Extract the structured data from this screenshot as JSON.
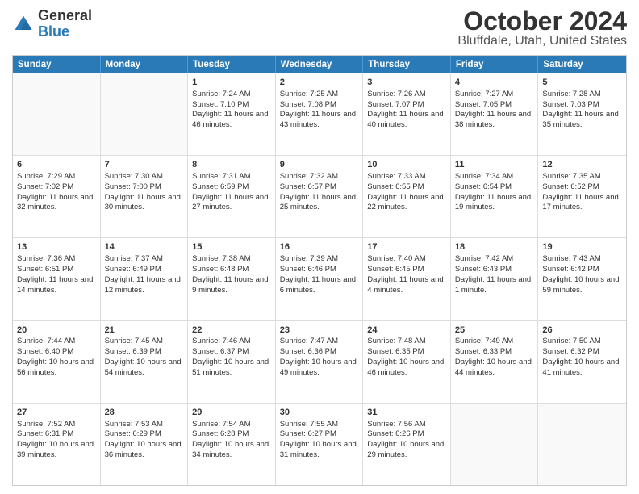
{
  "logo": {
    "line1": "General",
    "line2": "Blue"
  },
  "title": "October 2024",
  "subtitle": "Bluffdale, Utah, United States",
  "header_days": [
    "Sunday",
    "Monday",
    "Tuesday",
    "Wednesday",
    "Thursday",
    "Friday",
    "Saturday"
  ],
  "rows": [
    [
      {
        "day": "",
        "content": "",
        "empty": true
      },
      {
        "day": "",
        "content": "",
        "empty": true
      },
      {
        "day": "1",
        "content": "Sunrise: 7:24 AM\nSunset: 7:10 PM\nDaylight: 11 hours and 46 minutes."
      },
      {
        "day": "2",
        "content": "Sunrise: 7:25 AM\nSunset: 7:08 PM\nDaylight: 11 hours and 43 minutes."
      },
      {
        "day": "3",
        "content": "Sunrise: 7:26 AM\nSunset: 7:07 PM\nDaylight: 11 hours and 40 minutes."
      },
      {
        "day": "4",
        "content": "Sunrise: 7:27 AM\nSunset: 7:05 PM\nDaylight: 11 hours and 38 minutes."
      },
      {
        "day": "5",
        "content": "Sunrise: 7:28 AM\nSunset: 7:03 PM\nDaylight: 11 hours and 35 minutes."
      }
    ],
    [
      {
        "day": "6",
        "content": "Sunrise: 7:29 AM\nSunset: 7:02 PM\nDaylight: 11 hours and 32 minutes."
      },
      {
        "day": "7",
        "content": "Sunrise: 7:30 AM\nSunset: 7:00 PM\nDaylight: 11 hours and 30 minutes."
      },
      {
        "day": "8",
        "content": "Sunrise: 7:31 AM\nSunset: 6:59 PM\nDaylight: 11 hours and 27 minutes."
      },
      {
        "day": "9",
        "content": "Sunrise: 7:32 AM\nSunset: 6:57 PM\nDaylight: 11 hours and 25 minutes."
      },
      {
        "day": "10",
        "content": "Sunrise: 7:33 AM\nSunset: 6:55 PM\nDaylight: 11 hours and 22 minutes."
      },
      {
        "day": "11",
        "content": "Sunrise: 7:34 AM\nSunset: 6:54 PM\nDaylight: 11 hours and 19 minutes."
      },
      {
        "day": "12",
        "content": "Sunrise: 7:35 AM\nSunset: 6:52 PM\nDaylight: 11 hours and 17 minutes."
      }
    ],
    [
      {
        "day": "13",
        "content": "Sunrise: 7:36 AM\nSunset: 6:51 PM\nDaylight: 11 hours and 14 minutes."
      },
      {
        "day": "14",
        "content": "Sunrise: 7:37 AM\nSunset: 6:49 PM\nDaylight: 11 hours and 12 minutes."
      },
      {
        "day": "15",
        "content": "Sunrise: 7:38 AM\nSunset: 6:48 PM\nDaylight: 11 hours and 9 minutes."
      },
      {
        "day": "16",
        "content": "Sunrise: 7:39 AM\nSunset: 6:46 PM\nDaylight: 11 hours and 6 minutes."
      },
      {
        "day": "17",
        "content": "Sunrise: 7:40 AM\nSunset: 6:45 PM\nDaylight: 11 hours and 4 minutes."
      },
      {
        "day": "18",
        "content": "Sunrise: 7:42 AM\nSunset: 6:43 PM\nDaylight: 11 hours and 1 minute."
      },
      {
        "day": "19",
        "content": "Sunrise: 7:43 AM\nSunset: 6:42 PM\nDaylight: 10 hours and 59 minutes."
      }
    ],
    [
      {
        "day": "20",
        "content": "Sunrise: 7:44 AM\nSunset: 6:40 PM\nDaylight: 10 hours and 56 minutes."
      },
      {
        "day": "21",
        "content": "Sunrise: 7:45 AM\nSunset: 6:39 PM\nDaylight: 10 hours and 54 minutes."
      },
      {
        "day": "22",
        "content": "Sunrise: 7:46 AM\nSunset: 6:37 PM\nDaylight: 10 hours and 51 minutes."
      },
      {
        "day": "23",
        "content": "Sunrise: 7:47 AM\nSunset: 6:36 PM\nDaylight: 10 hours and 49 minutes."
      },
      {
        "day": "24",
        "content": "Sunrise: 7:48 AM\nSunset: 6:35 PM\nDaylight: 10 hours and 46 minutes."
      },
      {
        "day": "25",
        "content": "Sunrise: 7:49 AM\nSunset: 6:33 PM\nDaylight: 10 hours and 44 minutes."
      },
      {
        "day": "26",
        "content": "Sunrise: 7:50 AM\nSunset: 6:32 PM\nDaylight: 10 hours and 41 minutes."
      }
    ],
    [
      {
        "day": "27",
        "content": "Sunrise: 7:52 AM\nSunset: 6:31 PM\nDaylight: 10 hours and 39 minutes."
      },
      {
        "day": "28",
        "content": "Sunrise: 7:53 AM\nSunset: 6:29 PM\nDaylight: 10 hours and 36 minutes."
      },
      {
        "day": "29",
        "content": "Sunrise: 7:54 AM\nSunset: 6:28 PM\nDaylight: 10 hours and 34 minutes."
      },
      {
        "day": "30",
        "content": "Sunrise: 7:55 AM\nSunset: 6:27 PM\nDaylight: 10 hours and 31 minutes."
      },
      {
        "day": "31",
        "content": "Sunrise: 7:56 AM\nSunset: 6:26 PM\nDaylight: 10 hours and 29 minutes."
      },
      {
        "day": "",
        "content": "",
        "empty": true
      },
      {
        "day": "",
        "content": "",
        "empty": true
      }
    ]
  ]
}
